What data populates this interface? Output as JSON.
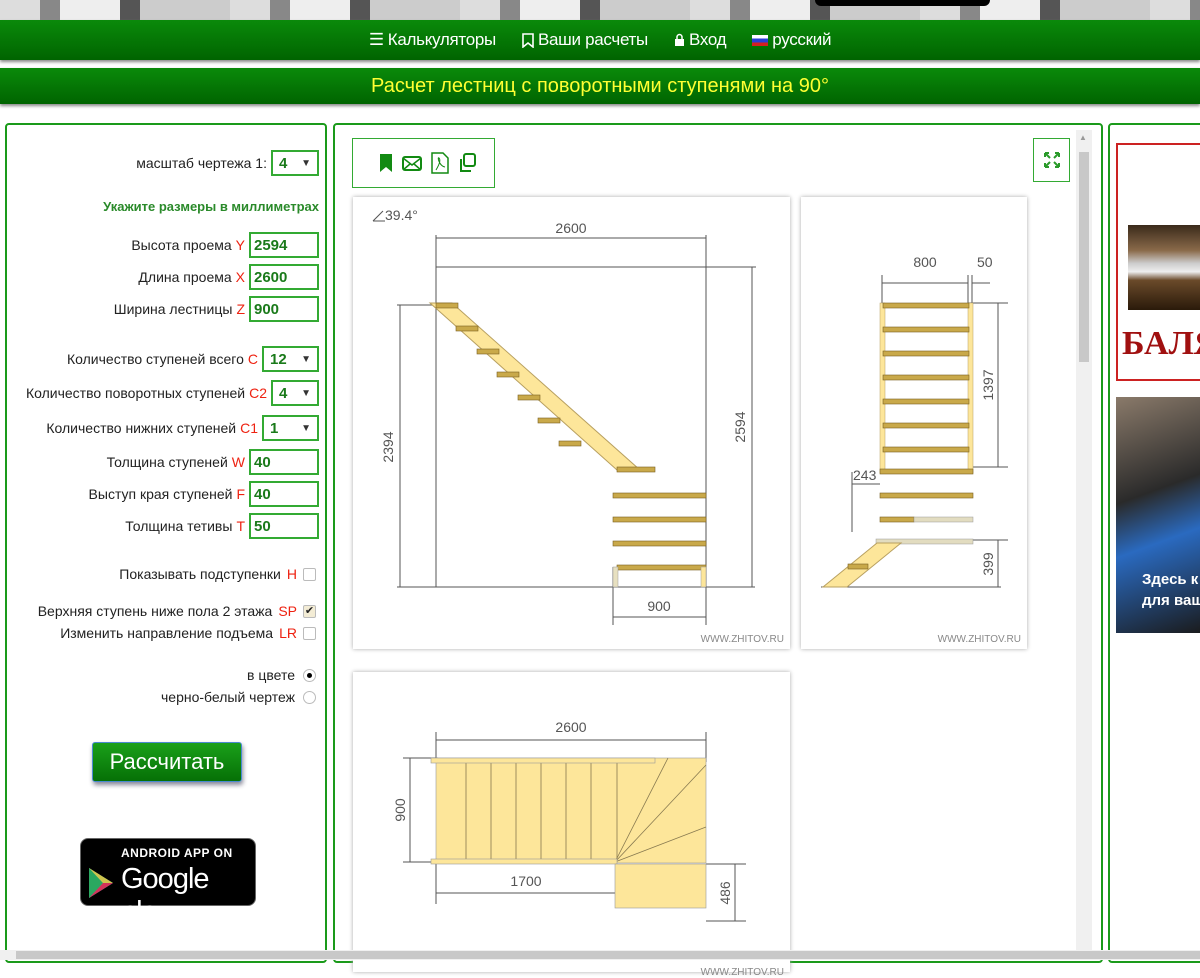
{
  "nav": {
    "items": [
      {
        "label": "Калькуляторы",
        "icon": "menu-icon"
      },
      {
        "label": "Ваши расчеты",
        "icon": "bookmark-icon"
      },
      {
        "label": "Вход",
        "icon": "lock-icon"
      },
      {
        "label": "русский",
        "icon": "russian-flag-icon"
      }
    ]
  },
  "title": "Расчет лестниц с поворотными ступенями на 90°",
  "form": {
    "scale": {
      "label": "масштаб чертежа 1:",
      "value": "4"
    },
    "hint": "Укажите размеры в миллиметрах",
    "height": {
      "label": "Высота проема",
      "code": "Y",
      "value": "2594"
    },
    "length": {
      "label": "Длина проема",
      "code": "X",
      "value": "2600"
    },
    "width": {
      "label": "Ширина лестницы",
      "code": "Z",
      "value": "900"
    },
    "steps_total": {
      "label": "Количество ступеней всего",
      "code": "C",
      "value": "12"
    },
    "steps_turn": {
      "label": "Количество поворотных ступеней",
      "code": "C2",
      "value": "4"
    },
    "steps_lower": {
      "label": "Количество нижних ступеней",
      "code": "C1",
      "value": "1"
    },
    "tread_thickness": {
      "label": "Толщина ступеней",
      "code": "W",
      "value": "40"
    },
    "nosing": {
      "label": "Выступ края ступеней",
      "code": "F",
      "value": "40"
    },
    "stringer": {
      "label": "Толщина тетивы",
      "code": "T",
      "value": "50"
    },
    "risers": {
      "label": "Показывать подступенки",
      "code": "H",
      "checked": false
    },
    "top_step": {
      "label": "Верхняя ступень ниже пола 2 этажа",
      "code": "SP",
      "checked": true
    },
    "direction": {
      "label": "Изменить направление подъема",
      "code": "LR",
      "checked": false
    },
    "color_mode": {
      "options": [
        "в цвете",
        "черно-белый чертеж"
      ],
      "selected": "в цвете"
    },
    "calc_button": "Рассчитать"
  },
  "gplay": {
    "line1": "ANDROID APP ON",
    "line2": "Google play"
  },
  "toolbar": {
    "icons": [
      "bookmark-icon",
      "email-icon",
      "pdf-icon",
      "copy-icon"
    ],
    "fullscreen": "fullscreen-icon"
  },
  "drawings": {
    "side": {
      "angle": "39.4°",
      "length": "2600",
      "left_height": "2394",
      "right_height": "2594",
      "width": "900",
      "watermark": "WWW.ZHITOV.RU"
    },
    "front": {
      "width": "800",
      "stringer": "50",
      "upper_height": "1397",
      "offset": "243",
      "lower_height": "399",
      "watermark": "WWW.ZHITOV.RU"
    },
    "plan": {
      "length": "2600",
      "width": "900",
      "flight": "1700",
      "landing": "486",
      "watermark": "WWW.ZHITOV.RU"
    }
  },
  "ads": {
    "ad1": "БАЛЯСИ",
    "ad2": [
      "Здесь к",
      "для ваш"
    ]
  },
  "colors": {
    "green": "#067006",
    "title_text": "#ffff33",
    "wood": "#fde69a",
    "tread": "#c9a94a"
  }
}
